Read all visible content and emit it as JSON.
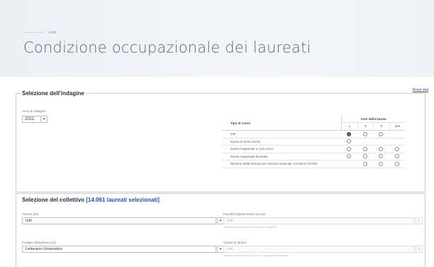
{
  "breadcrumb": {
    "home": "——— ——",
    "current": "Lauri"
  },
  "page": {
    "title": "Condizione occupazionale dei laureati",
    "reset_link": "Reset dati"
  },
  "indagine": {
    "legend": "Selezione dell'indagine",
    "year_label": "Anno di indagine",
    "year_value": "2021",
    "table": {
      "course_header": "Tipo di corso",
      "years_header": "Anni dalla laurea",
      "year_cols": [
        "1",
        "3",
        "5",
        "tutti"
      ],
      "rows": [
        {
          "label": "tutti",
          "radios": [
            "on",
            "off",
            "off",
            ""
          ]
        },
        {
          "label": "laurea di primo livello",
          "radios": [
            "off",
            "",
            "",
            ""
          ]
        },
        {
          "label": "laurea magistrale a ciclo unico",
          "radios": [
            "off",
            "off",
            "off",
            "off"
          ]
        },
        {
          "label": "laurea magistrale biennale",
          "radios": [
            "off",
            "off",
            "off",
            "off"
          ]
        },
        {
          "label": "Diploma della formazione artistica musicale coreutica (AFAM)",
          "radios": [
            "",
            "off",
            "off",
            "off"
          ]
        }
      ]
    }
  },
  "collettivo": {
    "legend": "Selezione del collettivo",
    "selected": "[14.061 laureati selezionati]",
    "ateneo_label": "Ateneo (22)",
    "ateneo_value": "tutti",
    "facolta_label": "Facoltà/ Dipartimento/ Scuola",
    "facolta_value": "tutti",
    "facolta_hint": "Seleziona prima l'Ateneo per poter scegliere",
    "gruppo_label": "Gruppo disciplinare (21)",
    "gruppo_value": "Letterario-Umanistico",
    "classe_label": "Classe di laurea",
    "classe_value": "tutti",
    "classe_hint": "Seleziona prima il tipo di corso e il gruppo disciplinare"
  }
}
